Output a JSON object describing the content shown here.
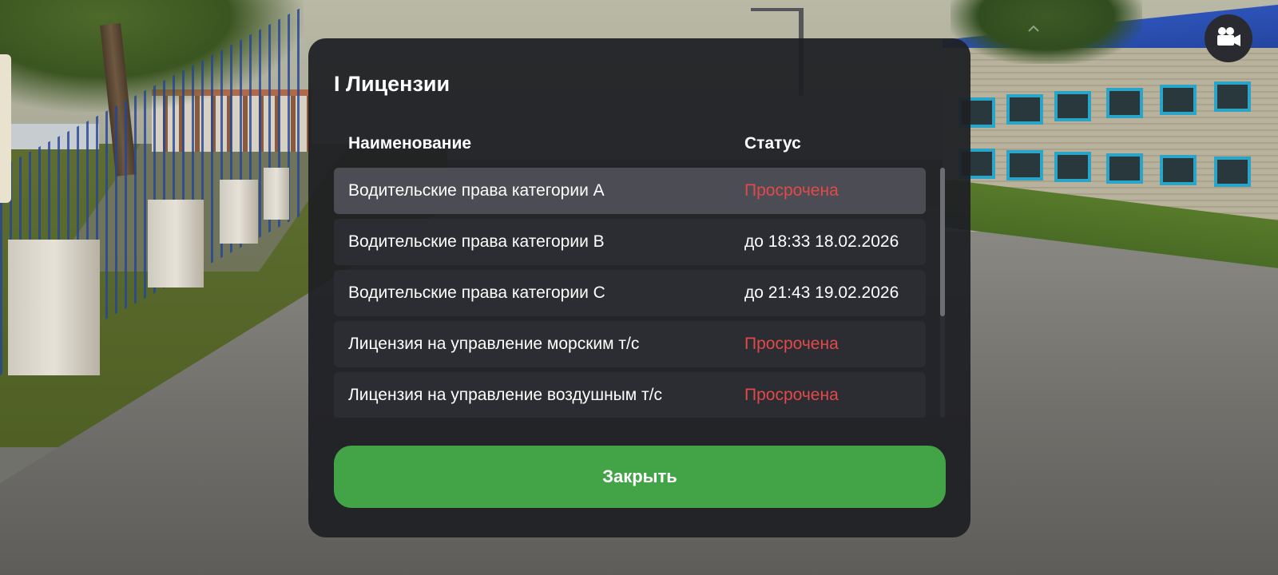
{
  "modal": {
    "title": "I Лицензии",
    "columns": {
      "name": "Наименование",
      "status": "Статус"
    },
    "rows": [
      {
        "name": "Водительские права категории A",
        "status": "Просрочена",
        "expired": true,
        "selected": true
      },
      {
        "name": "Водительские права категории B",
        "status": "до 18:33 18.02.2026",
        "expired": false,
        "selected": false
      },
      {
        "name": "Водительские права категории C",
        "status": "до 21:43 19.02.2026",
        "expired": false,
        "selected": false
      },
      {
        "name": "Лицензия на управление морским т/с",
        "status": "Просрочена",
        "expired": true,
        "selected": false
      },
      {
        "name": "Лицензия на управление воздушным т/с",
        "status": "Просрочена",
        "expired": true,
        "selected": false
      }
    ],
    "close_label": "Закрыть"
  },
  "hud": {
    "camera_icon": "video-camera-icon",
    "chevron_icon": "chevron-up-icon"
  },
  "colors": {
    "modal_bg": "#1f2024",
    "row_bg": "#2c2d32",
    "row_selected_bg": "#4b4c54",
    "expired": "#e14a4a",
    "close_button": "#43a347",
    "text": "#ffffff"
  }
}
